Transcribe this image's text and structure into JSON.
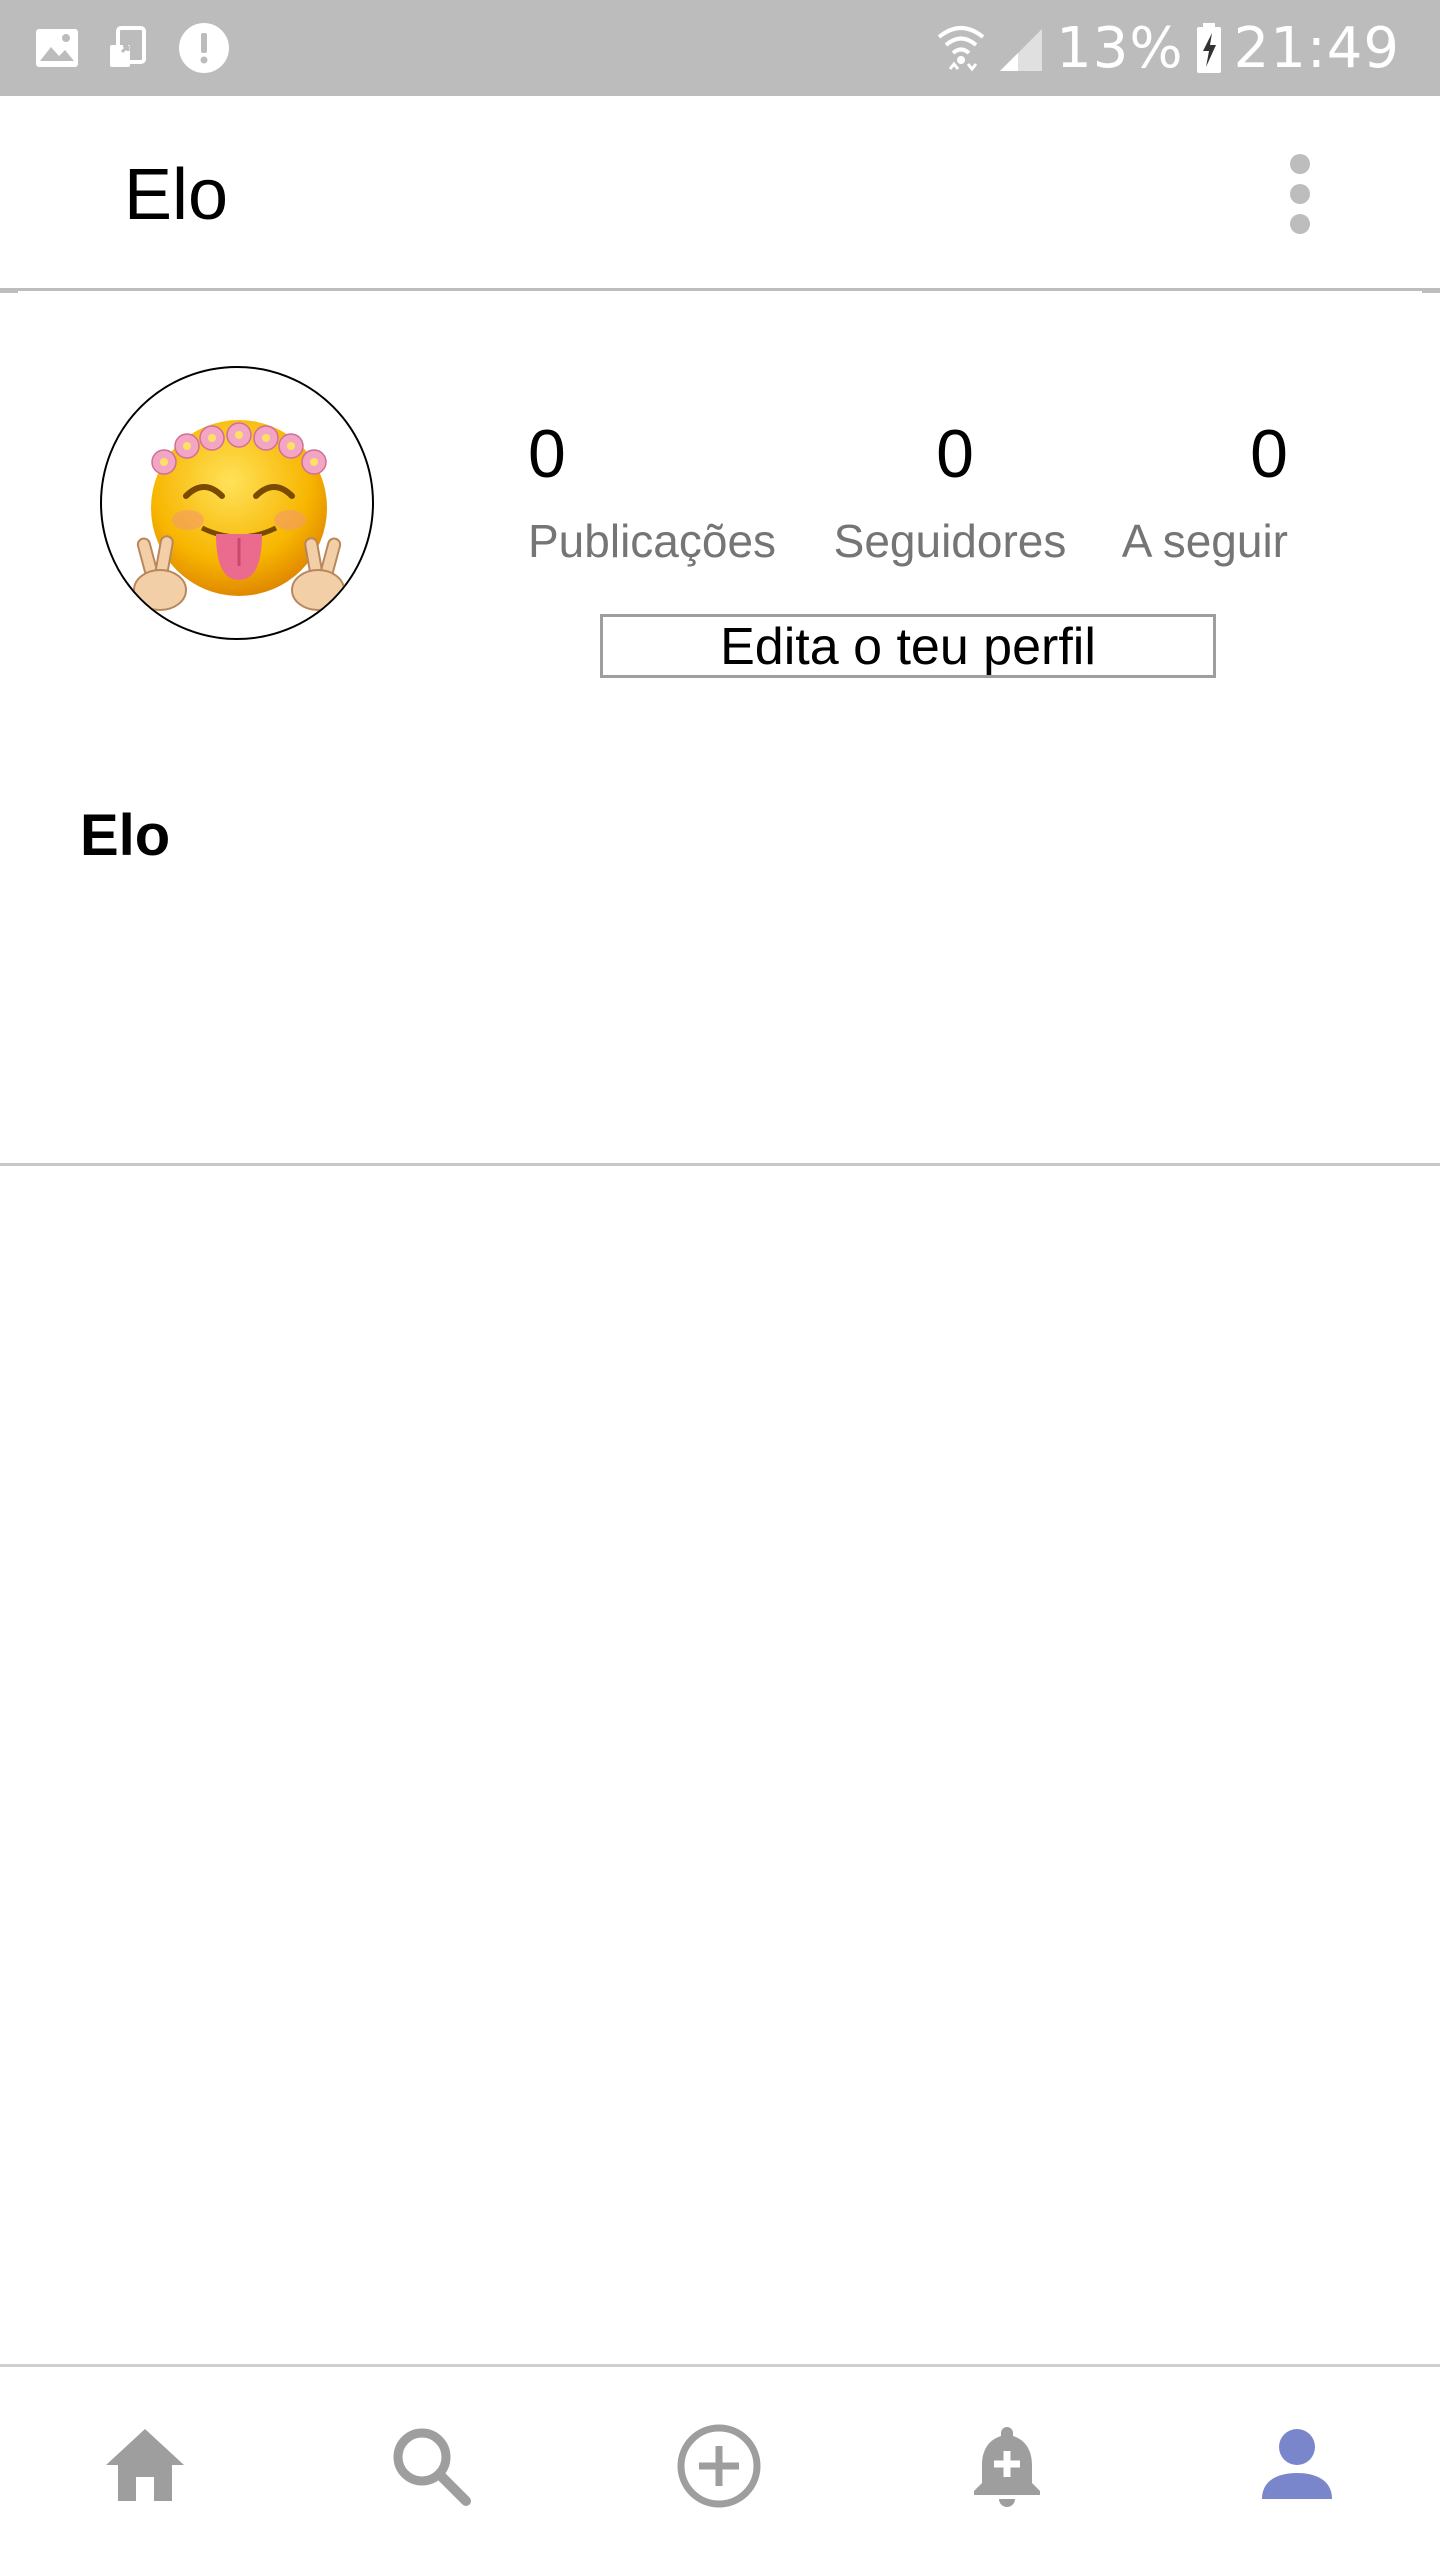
{
  "status_bar": {
    "battery": "13%",
    "time": "21:49",
    "icons": [
      "gallery-icon",
      "screen-mirror-icon",
      "alert-icon",
      "wifi-icon",
      "signal-icon",
      "battery-charging-icon"
    ]
  },
  "app_bar": {
    "title": "Elo",
    "menu_icon": "overflow-menu-icon"
  },
  "profile": {
    "avatar_icon": "emoji-flower-crown-avatar",
    "stats": [
      {
        "value": "0",
        "label": "Publicações"
      },
      {
        "value": "0",
        "label": "Seguidores"
      },
      {
        "value": "0",
        "label": "A seguir"
      }
    ],
    "edit_button_label": "Edita o teu perfil",
    "name": "Elo"
  },
  "bottom_nav": {
    "items": [
      {
        "icon": "home-icon",
        "active": false
      },
      {
        "icon": "search-icon",
        "active": false
      },
      {
        "icon": "add-circle-icon",
        "active": false
      },
      {
        "icon": "notification-add-icon",
        "active": false
      },
      {
        "icon": "profile-icon",
        "active": true
      }
    ],
    "inactive_color": "#9e9e9e",
    "active_color": "#7986cb"
  }
}
